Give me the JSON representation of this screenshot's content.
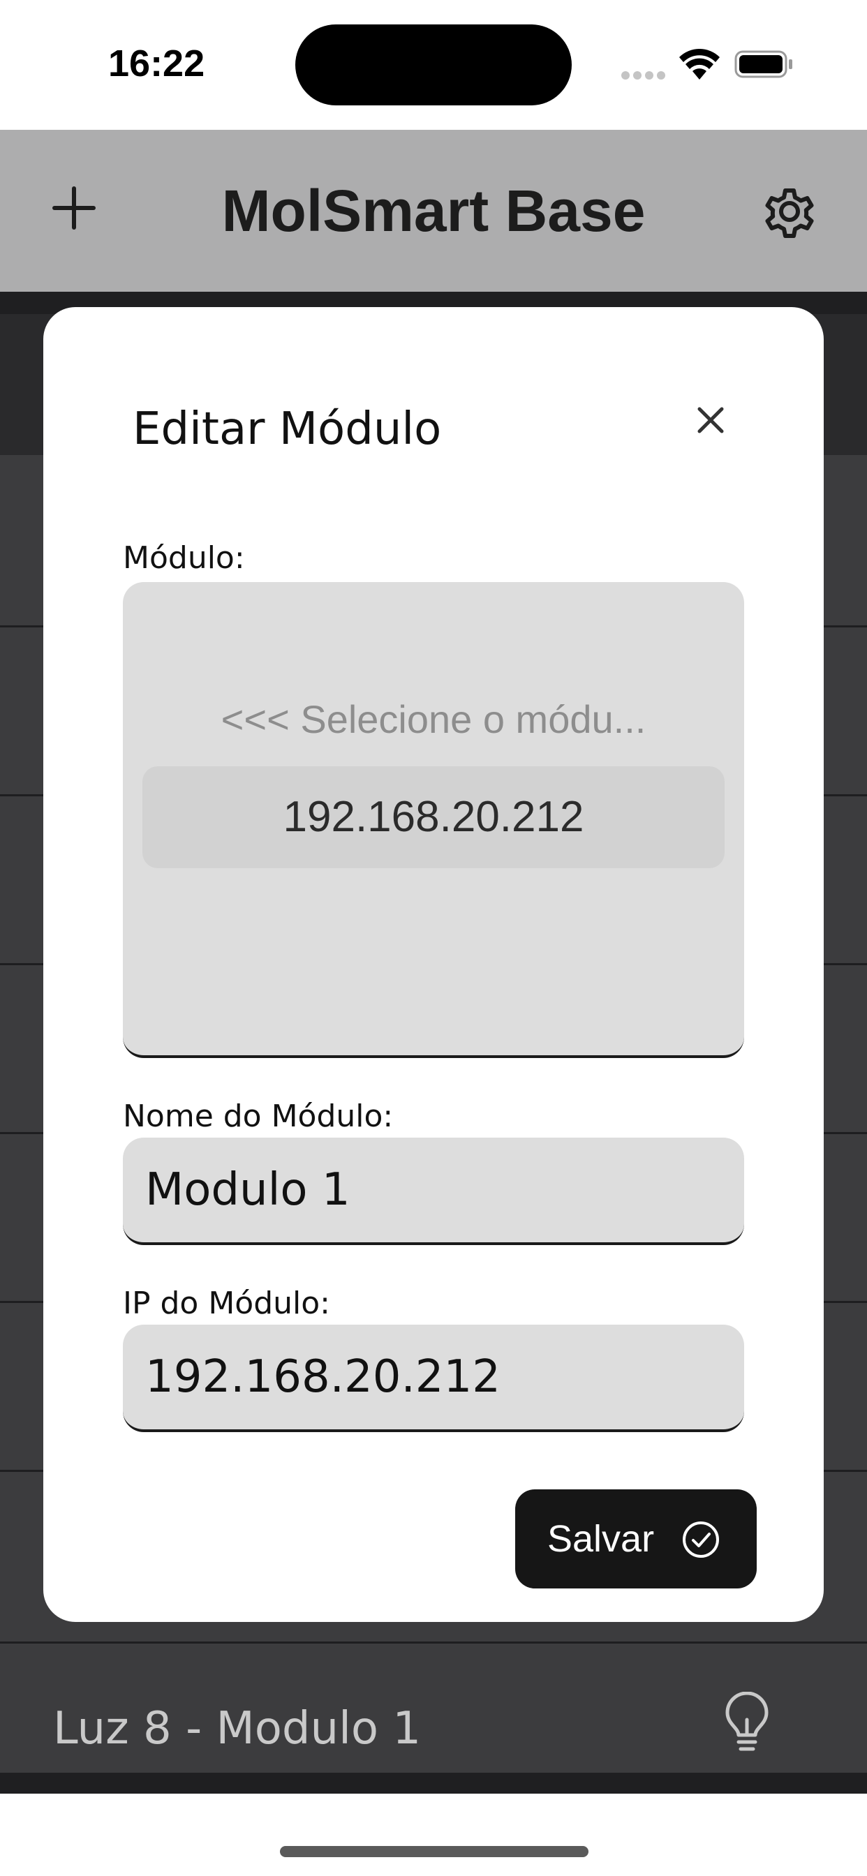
{
  "status_bar": {
    "time": "16:22"
  },
  "header": {
    "title": "MolSmart Base",
    "add_icon": "plus-icon",
    "settings_icon": "gear-icon"
  },
  "background_list": {
    "last_item_label": "Luz 8 - Modulo 1",
    "last_item_icon": "lightbulb-icon"
  },
  "modal": {
    "title": "Editar Módulo",
    "close_icon": "close-icon",
    "module_label": "Módulo:",
    "picker": {
      "placeholder": "<<< Selecione o módu...",
      "selected": "192.168.20.212"
    },
    "name_label": "Nome do Módulo:",
    "name_value": "Modulo 1",
    "ip_label": "IP do Módulo:",
    "ip_value": "192.168.20.212",
    "save_label": "Salvar",
    "save_icon": "check-circle-icon"
  },
  "colors": {
    "header_bg": "#adadae",
    "list_bg": "#3c3c3e",
    "field_bg": "#dddddd",
    "button_bg": "#161616"
  }
}
